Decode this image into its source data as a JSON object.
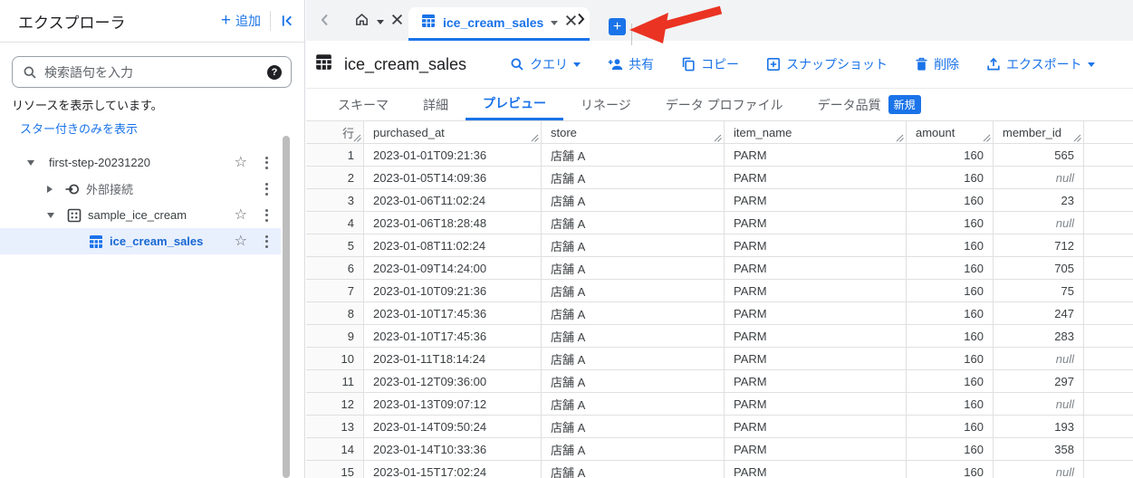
{
  "colors": {
    "accent": "#1a73e8",
    "selected_row_bg": "#e8f0fe",
    "selected_text": "#1967d2",
    "tabstrip_bg": "#f1f3f4",
    "border": "#e0e0e0",
    "null_text": "#80868b",
    "annotation_arrow": "#ea3323",
    "badge_bg": "#1a73e8"
  },
  "sidebar": {
    "title": "エクスプローラ",
    "add_label": "追加",
    "add_plus": "+",
    "collapse_icon": "collapse-panel-icon",
    "search_placeholder": "検索語句を入力",
    "help_icon": "?",
    "status_text": "リソースを表示しています。",
    "filter_link": "スター付きのみを表示",
    "tree": [
      {
        "label": "first-step-20231220",
        "type": "project",
        "expanded": true,
        "starred": false
      },
      {
        "label": "外部接続",
        "type": "external-connection",
        "expanded": false
      },
      {
        "label": "sample_ice_cream",
        "type": "dataset",
        "expanded": true
      },
      {
        "label": "ice_cream_sales",
        "type": "table",
        "selected": true
      }
    ]
  },
  "tabstrip": {
    "home_tab": "home",
    "active_tab_label": "ice_cream_sales",
    "new_tab_button": "+",
    "annotation": "red-arrow-pointing-at-new-tab-button"
  },
  "header": {
    "title": "ice_cream_sales",
    "actions": [
      {
        "label": "クエリ",
        "icon": "search-icon",
        "has_caret": true
      },
      {
        "label": "共有",
        "icon": "person-add-icon",
        "has_caret": false
      },
      {
        "label": "コピー",
        "icon": "copy-icon",
        "has_caret": false
      },
      {
        "label": "スナップショット",
        "icon": "snapshot-icon",
        "has_caret": false
      },
      {
        "label": "削除",
        "icon": "trash-icon",
        "has_caret": false
      },
      {
        "label": "エクスポート",
        "icon": "export-icon",
        "has_caret": true
      }
    ]
  },
  "subtabs": {
    "items": [
      {
        "label": "スキーマ"
      },
      {
        "label": "詳細"
      },
      {
        "label": "プレビュー",
        "active": true
      },
      {
        "label": "リネージ"
      },
      {
        "label": "データ プロファイル"
      },
      {
        "label": "データ品質"
      }
    ],
    "badge": "新規"
  },
  "table": {
    "row_header": "行",
    "columns": [
      "purchased_at",
      "store",
      "item_name",
      "amount",
      "member_id"
    ],
    "rows": [
      [
        "1",
        "2023-01-01T09:21:36",
        "店舗 A",
        "PARM",
        "160",
        "565"
      ],
      [
        "2",
        "2023-01-05T14:09:36",
        "店舗 A",
        "PARM",
        "160",
        "null"
      ],
      [
        "3",
        "2023-01-06T11:02:24",
        "店舗 A",
        "PARM",
        "160",
        "23"
      ],
      [
        "4",
        "2023-01-06T18:28:48",
        "店舗 A",
        "PARM",
        "160",
        "null"
      ],
      [
        "5",
        "2023-01-08T11:02:24",
        "店舗 A",
        "PARM",
        "160",
        "712"
      ],
      [
        "6",
        "2023-01-09T14:24:00",
        "店舗 A",
        "PARM",
        "160",
        "705"
      ],
      [
        "7",
        "2023-01-10T09:21:36",
        "店舗 A",
        "PARM",
        "160",
        "75"
      ],
      [
        "8",
        "2023-01-10T17:45:36",
        "店舗 A",
        "PARM",
        "160",
        "247"
      ],
      [
        "9",
        "2023-01-10T17:45:36",
        "店舗 A",
        "PARM",
        "160",
        "283"
      ],
      [
        "10",
        "2023-01-11T18:14:24",
        "店舗 A",
        "PARM",
        "160",
        "null"
      ],
      [
        "11",
        "2023-01-12T09:36:00",
        "店舗 A",
        "PARM",
        "160",
        "297"
      ],
      [
        "12",
        "2023-01-13T09:07:12",
        "店舗 A",
        "PARM",
        "160",
        "null"
      ],
      [
        "13",
        "2023-01-14T09:50:24",
        "店舗 A",
        "PARM",
        "160",
        "193"
      ],
      [
        "14",
        "2023-01-14T10:33:36",
        "店舗 A",
        "PARM",
        "160",
        "358"
      ],
      [
        "15",
        "2023-01-15T17:02:24",
        "店舗 A",
        "PARM",
        "160",
        "null"
      ]
    ]
  }
}
